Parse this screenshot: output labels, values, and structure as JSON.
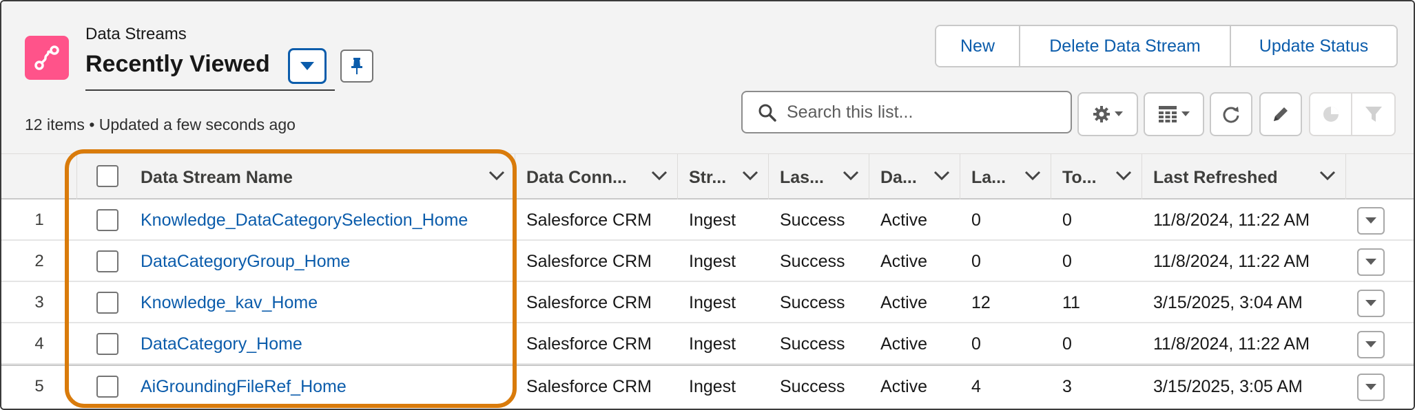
{
  "header": {
    "object_label": "Data Streams",
    "list_view_title": "Recently Viewed",
    "meta_info": "12 items • Updated a few seconds ago",
    "app_icon": "data-stream-icon",
    "accent_color": "#0b5cab",
    "app_icon_color": "#ff538a"
  },
  "actions": {
    "new_label": "New",
    "delete_label": "Delete Data Stream",
    "update_status_label": "Update Status"
  },
  "search": {
    "placeholder": "Search this list..."
  },
  "toolbar": {
    "settings_icon": "gear-icon",
    "display_as_icon": "table-icon",
    "refresh_icon": "refresh-icon",
    "edit_icon": "pencil-icon",
    "chart_icon": "pie-chart-icon",
    "filter_icon": "filter-icon"
  },
  "table": {
    "columns": [
      "Data Stream Name",
      "Data Conn...",
      "Str...",
      "Las...",
      "Da...",
      "La...",
      "To...",
      "Last Refreshed"
    ],
    "rows": [
      {
        "num": "1",
        "name": "Knowledge_DataCategorySelection_Home",
        "connector": "Salesforce CRM",
        "stream_type": "Ingest",
        "last_status": "Success",
        "data_status": "Active",
        "last_count": "0",
        "total": "0",
        "last_refreshed": "11/8/2024, 11:22 AM"
      },
      {
        "num": "2",
        "name": "DataCategoryGroup_Home",
        "connector": "Salesforce CRM",
        "stream_type": "Ingest",
        "last_status": "Success",
        "data_status": "Active",
        "last_count": "0",
        "total": "0",
        "last_refreshed": "11/8/2024, 11:22 AM"
      },
      {
        "num": "3",
        "name": "Knowledge_kav_Home",
        "connector": "Salesforce CRM",
        "stream_type": "Ingest",
        "last_status": "Success",
        "data_status": "Active",
        "last_count": "12",
        "total": "11",
        "last_refreshed": "3/15/2025, 3:04 AM"
      },
      {
        "num": "4",
        "name": "DataCategory_Home",
        "connector": "Salesforce CRM",
        "stream_type": "Ingest",
        "last_status": "Success",
        "data_status": "Active",
        "last_count": "0",
        "total": "0",
        "last_refreshed": "11/8/2024, 11:22 AM"
      },
      {
        "num": "5",
        "name": "AiGroundingFileRef_Home",
        "connector": "Salesforce CRM",
        "stream_type": "Ingest",
        "last_status": "Success",
        "data_status": "Active",
        "last_count": "4",
        "total": "3",
        "last_refreshed": "3/15/2025, 3:05 AM"
      }
    ]
  },
  "highlight_color": "#d97b0b"
}
